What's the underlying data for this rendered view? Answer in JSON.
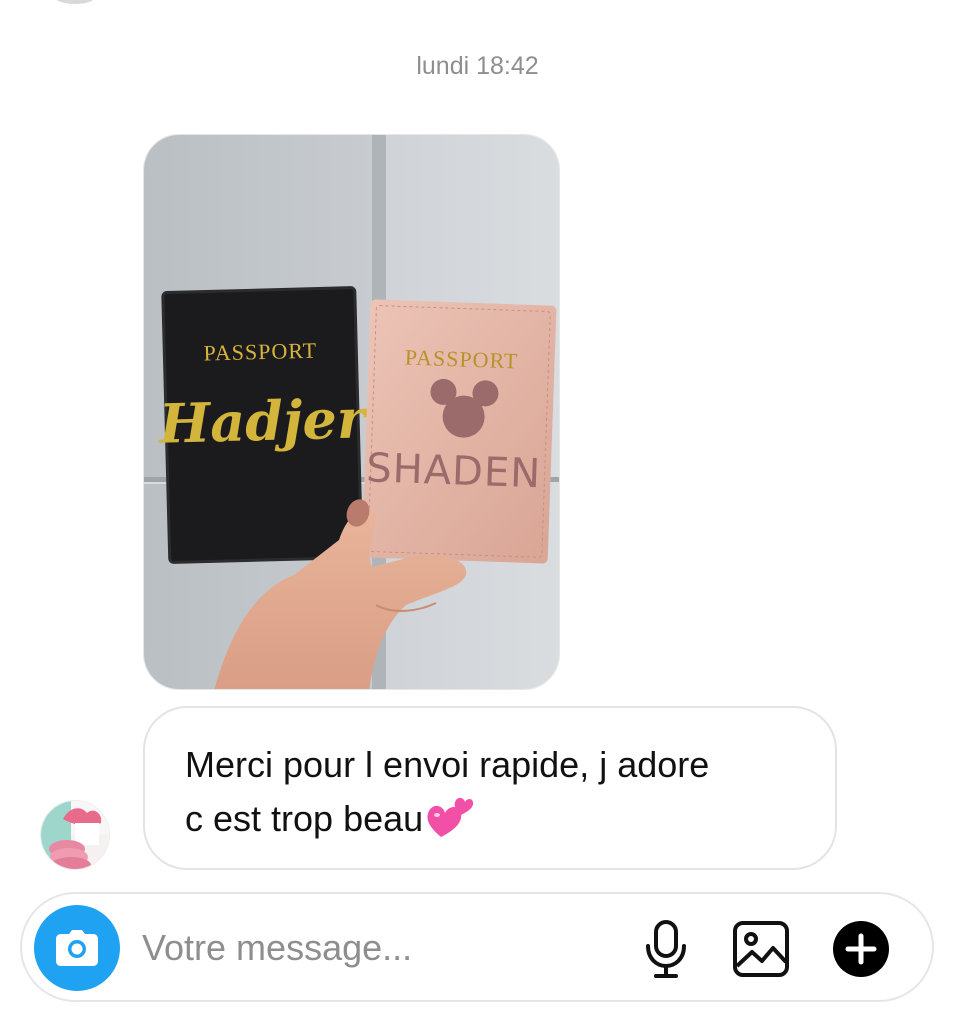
{
  "thread": {
    "timestamp": "lundi 18:42"
  },
  "photo": {
    "left_passport": {
      "heading": "PASSPORT",
      "name": "Hadjer",
      "color": "#1b1b1d"
    },
    "right_passport": {
      "heading": "PASSPORT",
      "name": "SHADEN",
      "color": "#e3b3a3"
    }
  },
  "message": {
    "line1": "Merci pour l envoi rapide, j adore",
    "line2": "c est trop beau",
    "emoji": "two-hearts-emoji"
  },
  "composer": {
    "placeholder": "Votre message...",
    "camera_icon": "camera-icon",
    "mic_icon": "microphone-icon",
    "gallery_icon": "image-gallery-icon",
    "plus_icon": "plus-circle-icon",
    "accent": "#1fa2f1"
  }
}
